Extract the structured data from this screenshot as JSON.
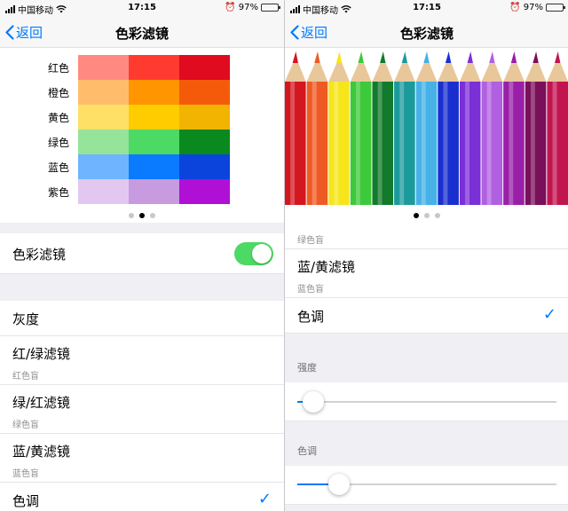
{
  "status": {
    "carrier": "中国移动",
    "time": "17:15",
    "battery": "97%",
    "battery_level": 0.97
  },
  "nav": {
    "back": "返回",
    "title": "色彩滤镜"
  },
  "color_grid": {
    "rows": [
      {
        "label": "红色",
        "colors": [
          "#ff8a82",
          "#ff3b30",
          "#e00b1f"
        ]
      },
      {
        "label": "橙色",
        "colors": [
          "#ffbd6b",
          "#ff9500",
          "#f55a0b"
        ]
      },
      {
        "label": "黄色",
        "colors": [
          "#ffe066",
          "#ffcc00",
          "#f2b400"
        ]
      },
      {
        "label": "绿色",
        "colors": [
          "#96e39a",
          "#4cd964",
          "#0a8a1e"
        ]
      },
      {
        "label": "蓝色",
        "colors": [
          "#6eb4ff",
          "#0a7aff",
          "#0a44dd"
        ]
      },
      {
        "label": "紫色",
        "colors": [
          "#e2c8f0",
          "#c89be0",
          "#b00fd6"
        ]
      }
    ]
  },
  "pencil_colors": [
    "#d3161f",
    "#ef5a24",
    "#f6e51b",
    "#3cc93a",
    "#127a2b",
    "#1b9a9c",
    "#45b1e6",
    "#1a2fd0",
    "#7b2fd6",
    "#b060e0",
    "#9a1fa8",
    "#7a0f5a",
    "#c2154f"
  ],
  "left": {
    "filter_toggle": {
      "label": "色彩滤镜",
      "on": true
    },
    "options": [
      {
        "title": "灰度",
        "sub": ""
      },
      {
        "title": "红/绿滤镜",
        "sub": "红色盲"
      },
      {
        "title": "绿/红滤镜",
        "sub": "绿色盲"
      },
      {
        "title": "蓝/黄滤镜",
        "sub": "蓝色盲"
      },
      {
        "title": "色调",
        "sub": "",
        "checked": true
      }
    ]
  },
  "right": {
    "partial_sub": "绿色盲",
    "options": [
      {
        "title": "蓝/黄滤镜",
        "sub": "蓝色盲"
      },
      {
        "title": "色调",
        "sub": "",
        "checked": true
      }
    ],
    "intensity": {
      "label": "强度",
      "value": 0.06
    },
    "hue": {
      "label": "色调",
      "value": 0.16
    }
  },
  "checkmark": "✓",
  "page_dots": {
    "count": 3,
    "left_active": 1,
    "right_active": 0
  }
}
